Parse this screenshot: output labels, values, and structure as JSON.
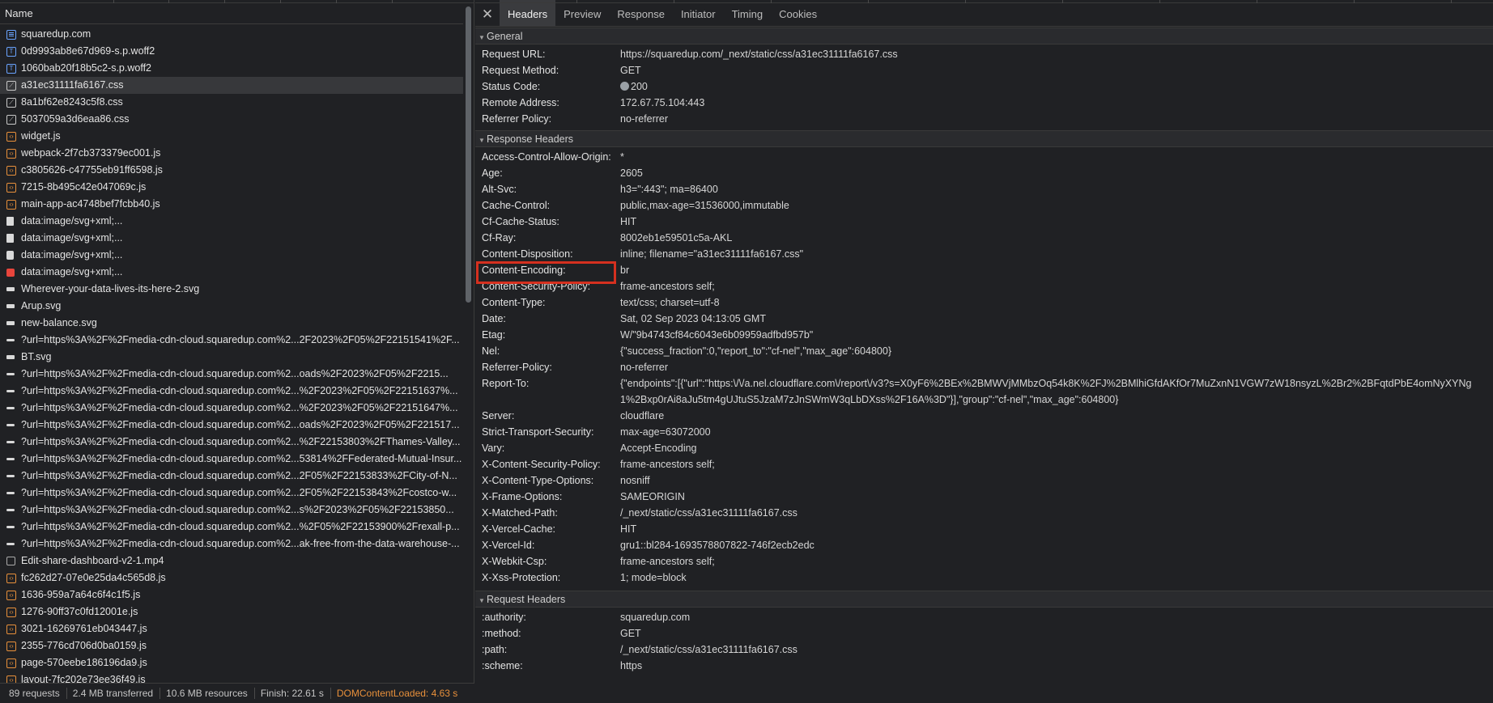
{
  "list": {
    "column_header": "Name",
    "rows": [
      {
        "name": "squaredup.com",
        "icon": "document-icon",
        "type": "doc"
      },
      {
        "name": "0d9993ab8e67d969-s.p.woff2",
        "icon": "font-icon",
        "type": "font"
      },
      {
        "name": "1060bab20f18b5c2-s.p.woff2",
        "icon": "font-icon",
        "type": "font"
      },
      {
        "name": "a31ec31111fa6167.css",
        "icon": "stylesheet-icon",
        "type": "css",
        "selected": true
      },
      {
        "name": "8a1bf62e8243c5f8.css",
        "icon": "stylesheet-icon",
        "type": "css"
      },
      {
        "name": "5037059a3d6eaa86.css",
        "icon": "stylesheet-icon",
        "type": "css"
      },
      {
        "name": "widget.js",
        "icon": "script-icon",
        "type": "js"
      },
      {
        "name": "webpack-2f7cb373379ec001.js",
        "icon": "script-icon",
        "type": "js"
      },
      {
        "name": "c3805626-c47755eb91ff6598.js",
        "icon": "script-icon",
        "type": "js"
      },
      {
        "name": "7215-8b495c42e047069c.js",
        "icon": "script-icon",
        "type": "js"
      },
      {
        "name": "main-app-ac4748bef7fcbb40.js",
        "icon": "script-icon",
        "type": "js"
      },
      {
        "name": "data:image/svg+xml;...",
        "icon": "image-icon",
        "type": "imgw"
      },
      {
        "name": "data:image/svg+xml;...",
        "icon": "image-icon",
        "type": "imgw"
      },
      {
        "name": "data:image/svg+xml;...",
        "icon": "image-icon",
        "type": "imgdark"
      },
      {
        "name": "data:image/svg+xml;...",
        "icon": "image-icon",
        "type": "imgred"
      },
      {
        "name": "Wherever-your-data-lives-its-here-2.svg",
        "icon": "image-icon",
        "type": "bar"
      },
      {
        "name": "Arup.svg",
        "icon": "image-icon",
        "type": "bar"
      },
      {
        "name": "new-balance.svg",
        "icon": "image-icon",
        "type": "bar"
      },
      {
        "name": "?url=https%3A%2F%2Fmedia-cdn-cloud.squaredup.com%2...2F2023%2F05%2F22151541%2F...",
        "icon": "image-icon",
        "type": "barthin"
      },
      {
        "name": "BT.svg",
        "icon": "image-icon",
        "type": "bar"
      },
      {
        "name": "?url=https%3A%2F%2Fmedia-cdn-cloud.squaredup.com%2...oads%2F2023%2F05%2F2215...",
        "icon": "image-icon",
        "type": "barthin"
      },
      {
        "name": "?url=https%3A%2F%2Fmedia-cdn-cloud.squaredup.com%2...%2F2023%2F05%2F22151637%...",
        "icon": "image-icon",
        "type": "barthin"
      },
      {
        "name": "?url=https%3A%2F%2Fmedia-cdn-cloud.squaredup.com%2...%2F2023%2F05%2F22151647%...",
        "icon": "image-icon",
        "type": "barthin"
      },
      {
        "name": "?url=https%3A%2F%2Fmedia-cdn-cloud.squaredup.com%2...oads%2F2023%2F05%2F221517...",
        "icon": "image-icon",
        "type": "barthin"
      },
      {
        "name": "?url=https%3A%2F%2Fmedia-cdn-cloud.squaredup.com%2...%2F22153803%2FThames-Valley...",
        "icon": "image-icon",
        "type": "barthin"
      },
      {
        "name": "?url=https%3A%2F%2Fmedia-cdn-cloud.squaredup.com%2...53814%2FFederated-Mutual-Insur...",
        "icon": "image-icon",
        "type": "barthin"
      },
      {
        "name": "?url=https%3A%2F%2Fmedia-cdn-cloud.squaredup.com%2...2F05%2F22153833%2FCity-of-N...",
        "icon": "image-icon",
        "type": "barthin"
      },
      {
        "name": "?url=https%3A%2F%2Fmedia-cdn-cloud.squaredup.com%2...2F05%2F22153843%2Fcostco-w...",
        "icon": "image-icon",
        "type": "barthin"
      },
      {
        "name": "?url=https%3A%2F%2Fmedia-cdn-cloud.squaredup.com%2...s%2F2023%2F05%2F22153850...",
        "icon": "image-icon",
        "type": "barthin"
      },
      {
        "name": "?url=https%3A%2F%2Fmedia-cdn-cloud.squaredup.com%2...%2F05%2F22153900%2Frexall-p...",
        "icon": "image-icon",
        "type": "barthin"
      },
      {
        "name": "?url=https%3A%2F%2Fmedia-cdn-cloud.squaredup.com%2...ak-free-from-the-data-warehouse-...",
        "icon": "image-icon",
        "type": "barthin"
      },
      {
        "name": "Edit-share-dashboard-v2-1.mp4",
        "icon": "media-icon",
        "type": "media"
      },
      {
        "name": "fc262d27-07e0e25da4c565d8.js",
        "icon": "script-icon",
        "type": "js"
      },
      {
        "name": "1636-959a7a64c6f4c1f5.js",
        "icon": "script-icon",
        "type": "js"
      },
      {
        "name": "1276-90ff37c0fd12001e.js",
        "icon": "script-icon",
        "type": "js"
      },
      {
        "name": "3021-16269761eb043447.js",
        "icon": "script-icon",
        "type": "js"
      },
      {
        "name": "2355-776cd706d0ba0159.js",
        "icon": "script-icon",
        "type": "js"
      },
      {
        "name": "page-570eebe186196da9.js",
        "icon": "script-icon",
        "type": "js"
      },
      {
        "name": "layout-7fc202e73ee36f49.js",
        "icon": "script-icon",
        "type": "js"
      }
    ]
  },
  "status": {
    "requests": "89 requests",
    "transferred": "2.4 MB transferred",
    "resources": "10.6 MB resources",
    "finish": "Finish: 22.61 s",
    "dom_content_loaded": "DOMContentLoaded: 4.63 s"
  },
  "tabs": {
    "close_glyph": "✕",
    "items": [
      "Headers",
      "Preview",
      "Response",
      "Initiator",
      "Timing",
      "Cookies"
    ],
    "active": "Headers"
  },
  "general": {
    "title": "General",
    "rows": [
      {
        "k": "Request URL:",
        "v": "https://squaredup.com/_next/static/css/a31ec31111fa6167.css"
      },
      {
        "k": "Request Method:",
        "v": "GET"
      },
      {
        "k": "Status Code:",
        "v": "200"
      },
      {
        "k": "Remote Address:",
        "v": "172.67.75.104:443"
      },
      {
        "k": "Referrer Policy:",
        "v": "no-referrer"
      }
    ]
  },
  "response_headers": {
    "title": "Response Headers",
    "rows": [
      {
        "k": "Access-Control-Allow-Origin:",
        "v": "*"
      },
      {
        "k": "Age:",
        "v": "2605"
      },
      {
        "k": "Alt-Svc:",
        "v": "h3=\":443\"; ma=86400"
      },
      {
        "k": "Cache-Control:",
        "v": "public,max-age=31536000,immutable"
      },
      {
        "k": "Cf-Cache-Status:",
        "v": "HIT"
      },
      {
        "k": "Cf-Ray:",
        "v": "8002eb1e59501c5a-AKL"
      },
      {
        "k": "Content-Disposition:",
        "v": "inline; filename=\"a31ec31111fa6167.css\""
      },
      {
        "k": "Content-Encoding:",
        "v": "br",
        "highlight": true
      },
      {
        "k": "Content-Security-Policy:",
        "v": "frame-ancestors self;"
      },
      {
        "k": "Content-Type:",
        "v": "text/css; charset=utf-8"
      },
      {
        "k": "Date:",
        "v": "Sat, 02 Sep 2023 04:13:05 GMT"
      },
      {
        "k": "Etag:",
        "v": "W/\"9b4743cf84c6043e6b09959adfbd957b\""
      },
      {
        "k": "Nel:",
        "v": "{\"success_fraction\":0,\"report_to\":\"cf-nel\",\"max_age\":604800}"
      },
      {
        "k": "Referrer-Policy:",
        "v": "no-referrer"
      },
      {
        "k": "Report-To:",
        "v": "{\"endpoints\":[{\"url\":\"https:\\/\\/a.nel.cloudflare.com\\/report\\/v3?s=X0yF6%2BEx%2BMWVjMMbzOq54k8K%2FJ%2BMlhiGfdAKfOr7MuZxnN1VGW7zW18nsyzL%2Br2%2BFqtdPbE4omNyXYNg1%2Bxp0rAi8aJu5tm4gUJtuS5JzaM7zJnSWmW3qLbDXss%2F16A%3D\"}],\"group\":\"cf-nel\",\"max_age\":604800}"
      },
      {
        "k": "Server:",
        "v": "cloudflare"
      },
      {
        "k": "Strict-Transport-Security:",
        "v": "max-age=63072000"
      },
      {
        "k": "Vary:",
        "v": "Accept-Encoding"
      },
      {
        "k": "X-Content-Security-Policy:",
        "v": "frame-ancestors self;"
      },
      {
        "k": "X-Content-Type-Options:",
        "v": "nosniff"
      },
      {
        "k": "X-Frame-Options:",
        "v": "SAMEORIGIN"
      },
      {
        "k": "X-Matched-Path:",
        "v": "/_next/static/css/a31ec31111fa6167.css"
      },
      {
        "k": "X-Vercel-Cache:",
        "v": "HIT"
      },
      {
        "k": "X-Vercel-Id:",
        "v": "gru1::bl284-1693578807822-746f2ecb2edc"
      },
      {
        "k": "X-Webkit-Csp:",
        "v": "frame-ancestors self;"
      },
      {
        "k": "X-Xss-Protection:",
        "v": "1; mode=block"
      }
    ]
  },
  "request_headers": {
    "title": "Request Headers",
    "rows": [
      {
        "k": ":authority:",
        "v": "squaredup.com"
      },
      {
        "k": ":method:",
        "v": "GET"
      },
      {
        "k": ":path:",
        "v": "/_next/static/css/a31ec31111fa6167.css"
      },
      {
        "k": ":scheme:",
        "v": "https"
      }
    ]
  },
  "colors": {
    "highlight_box": "#d5301f",
    "dom_content_loaded": "#e8903b",
    "js_icon": "#e8903b",
    "doc_icon": "#6aa4ff"
  }
}
